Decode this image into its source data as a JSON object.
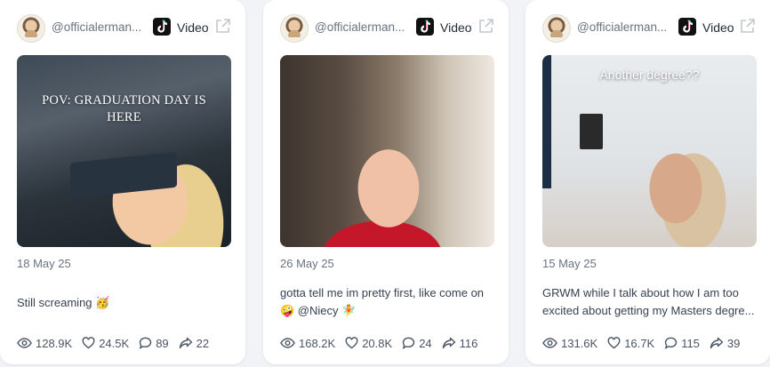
{
  "posts": [
    {
      "username": "@officialerman...",
      "platform": "Video",
      "overlay_text": "POV: GRADUATION DAY IS HERE",
      "date": "18 May 25",
      "caption_lines": [
        "Still screaming 🥳"
      ],
      "stats": {
        "views": "128.9K",
        "likes": "24.5K",
        "comments": "89",
        "shares": "22"
      }
    },
    {
      "username": "@officialerman...",
      "platform": "Video",
      "overlay_text": "",
      "date": "26 May 25",
      "caption_lines": [
        "gotta tell me im pretty first, like come on",
        "🤪 @Niecy 🧚"
      ],
      "stats": {
        "views": "168.2K",
        "likes": "20.8K",
        "comments": "24",
        "shares": "116"
      }
    },
    {
      "username": "@officialerman...",
      "platform": "Video",
      "overlay_text": "Another degree??",
      "date": "15 May 25",
      "caption_lines": [
        "GRWM while I talk about how I am too",
        "excited about getting my Masters degre..."
      ],
      "stats": {
        "views": "131.6K",
        "likes": "16.7K",
        "comments": "115",
        "shares": "39"
      }
    }
  ],
  "icons": {
    "platform": "tiktok-icon",
    "external": "external-link-icon",
    "views": "eye-icon",
    "likes": "heart-icon",
    "comments": "comment-icon",
    "shares": "share-icon"
  },
  "colors": {
    "card": "#ffffff",
    "background": "#f1f3f6",
    "muted": "#6b7280",
    "text": "#374151"
  }
}
